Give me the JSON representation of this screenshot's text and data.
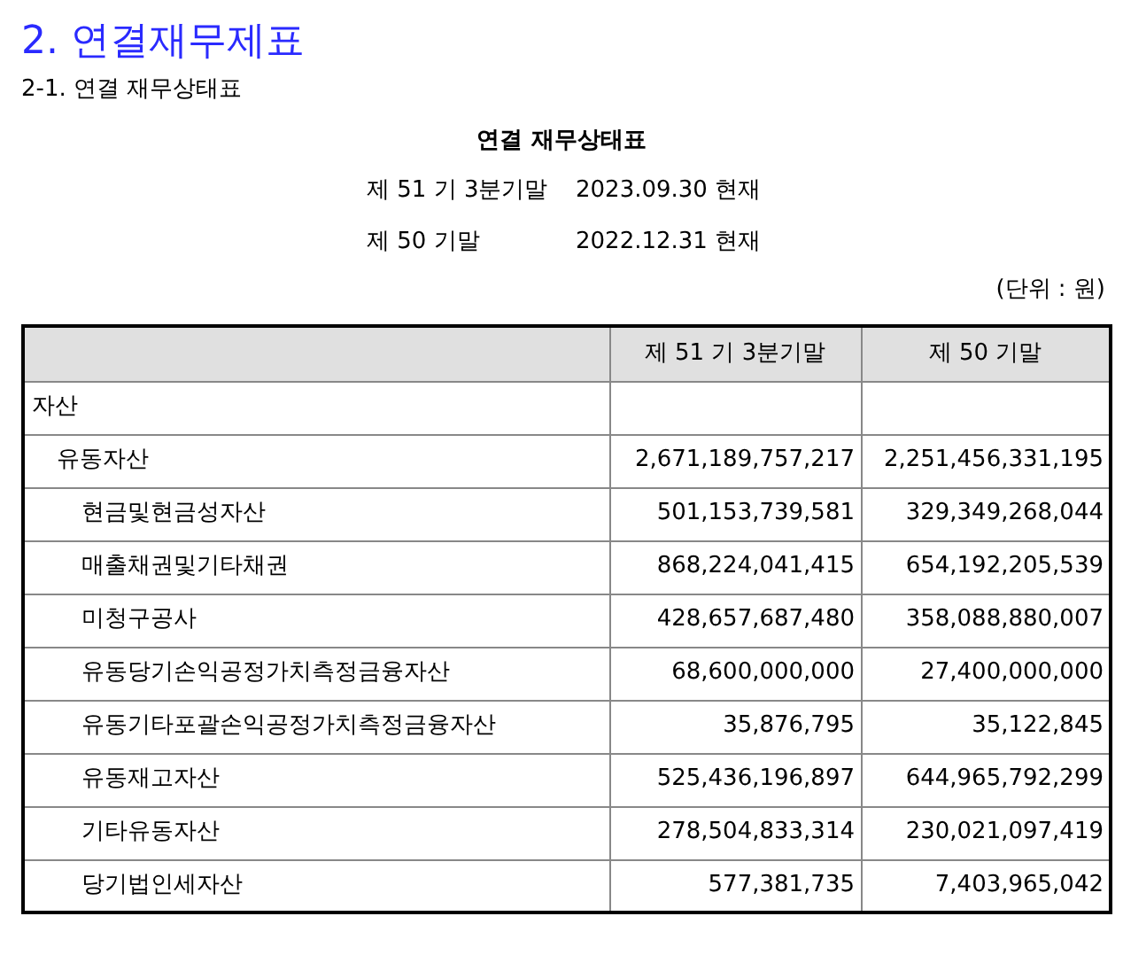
{
  "heading": "2. 연결재무제표",
  "subheading": "2-1. 연결 재무상태표",
  "statement": {
    "title": "연결 재무상태표",
    "periods": [
      {
        "label": "제 51 기 3분기말",
        "date": "2023.09.30 현재"
      },
      {
        "label": "제 50 기말",
        "date": "2022.12.31 현재"
      }
    ],
    "unit": "(단위 : 원)"
  },
  "table": {
    "columns": [
      "제 51 기 3분기말",
      "제 50 기말"
    ],
    "rows": [
      {
        "label": "자산",
        "values": [],
        "children": [
          {
            "label": "유동자산",
            "values": [
              "2,671,189,757,217",
              "2,251,456,331,195"
            ],
            "children": [
              {
                "label": "현금및현금성자산",
                "values": [
                  "501,153,739,581",
                  "329,349,268,044"
                ]
              },
              {
                "label": "매출채권및기타채권",
                "values": [
                  "868,224,041,415",
                  "654,192,205,539"
                ]
              },
              {
                "label": "미청구공사",
                "values": [
                  "428,657,687,480",
                  "358,088,880,007"
                ]
              },
              {
                "label": "유동당기손익공정가치측정금융자산",
                "values": [
                  "68,600,000,000",
                  "27,400,000,000"
                ]
              },
              {
                "label": "유동기타포괄손익공정가치측정금융자산",
                "values": [
                  "35,876,795",
                  "35,122,845"
                ]
              },
              {
                "label": "유동재고자산",
                "values": [
                  "525,436,196,897",
                  "644,965,792,299"
                ]
              },
              {
                "label": "기타유동자산",
                "values": [
                  "278,504,833,314",
                  "230,021,097,419"
                ]
              },
              {
                "label": "당기법인세자산",
                "values": [
                  "577,381,735",
                  "7,403,965,042"
                ]
              }
            ]
          }
        ]
      }
    ]
  }
}
